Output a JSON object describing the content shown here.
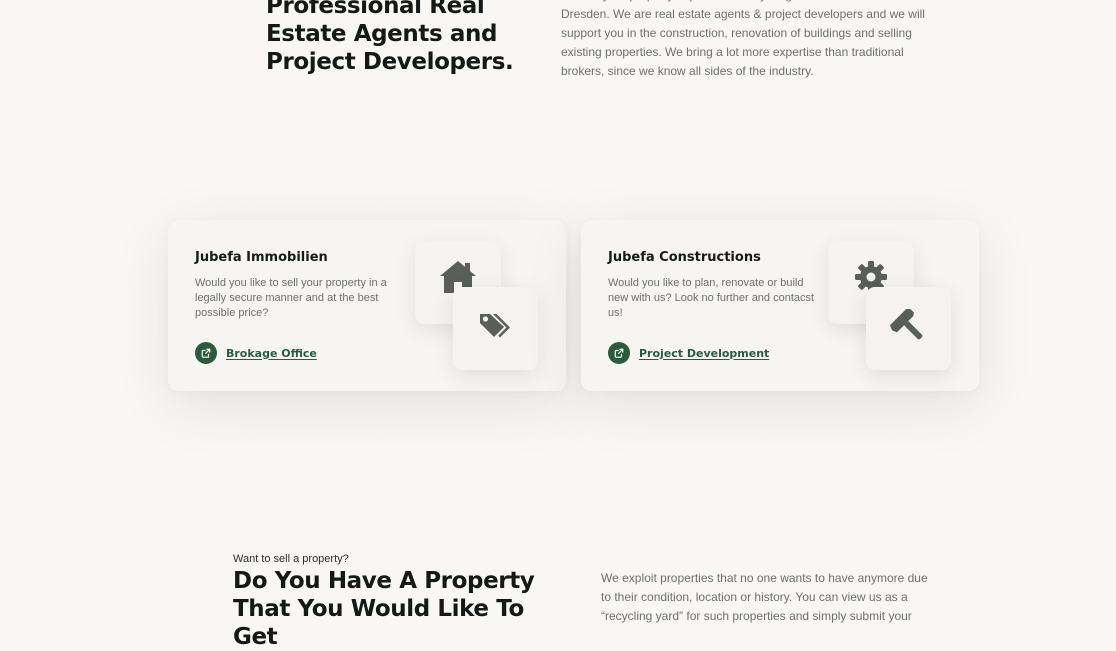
{
  "intro": {
    "heading": "Professional Real Estate Agents and Project Developers.",
    "text_partial": "We are your property experts for everything related to real estate in\nDresden. We are real estate agents & project developers and we will\nsupport you in the construction, renovation of buildings and selling\nexisting properties. We bring a lot more expertise than traditional\nbrokers, since we know all sides of the industry."
  },
  "cards": [
    {
      "title": "Jubefa Immobilien",
      "description": "Would you like to sell your property in a\nlegally secure manner and at the best\npossible price?",
      "link_label": "Brokage Office",
      "link_icon": "external-link-icon",
      "tile_back_icon": "house-icon",
      "tile_front_icon": "tags-icon"
    },
    {
      "title": "Jubefa Constructions",
      "description": "Would you like to plan, renovate or build\nnew with us? Look no further and contacst\nus!",
      "link_label": "Project Development",
      "link_icon": "external-link-icon",
      "tile_back_icon": "gear-icon",
      "tile_front_icon": "hammer-icon"
    }
  ],
  "sell_section": {
    "kicker": "Want to sell a property?",
    "heading": "Do You Have A Property That You Would Like To Get",
    "text": "We exploit properties that no one wants to have anymore due\nto their condition, location or history. You can view us as a\n“recycling yard” for such properties and simply submit your"
  },
  "colors": {
    "background": "#f8f7f3",
    "card_background": "#f6f5f1",
    "accent_green": "#2b5a3e",
    "icon_gray": "#5a5e5a",
    "heading_text": "#141816",
    "body_text": "#6c706d"
  }
}
